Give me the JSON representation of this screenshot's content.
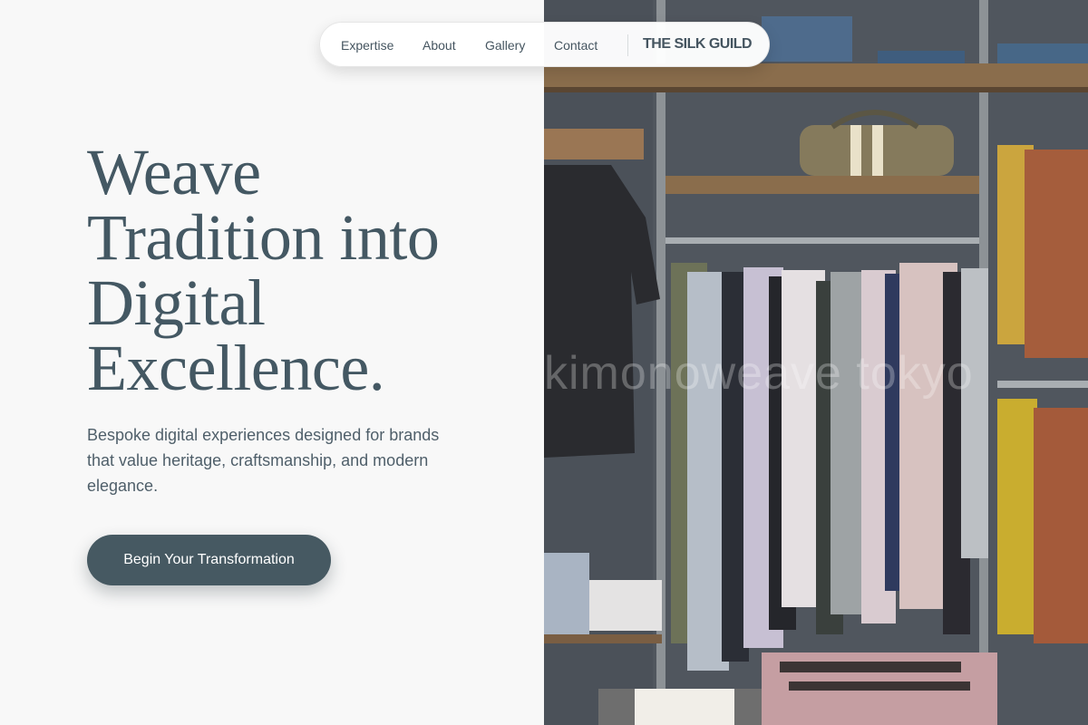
{
  "nav": {
    "links": [
      "Expertise",
      "About",
      "Gallery",
      "Contact"
    ],
    "brand": "THE SILK GUILD"
  },
  "hero": {
    "title_lines": [
      "Weave",
      "Tradition into",
      "Digital",
      "Excellence."
    ],
    "subtitle": "Bespoke digital experiences designed for brands that value heritage, craftsmanship, and modern elegance.",
    "cta_label": "Begin Your Transformation"
  },
  "photo": {
    "watermark": "kimonoweave tokyo"
  },
  "colors": {
    "primary": "#465962",
    "text": "#455560",
    "background": "#f8f8f8"
  }
}
